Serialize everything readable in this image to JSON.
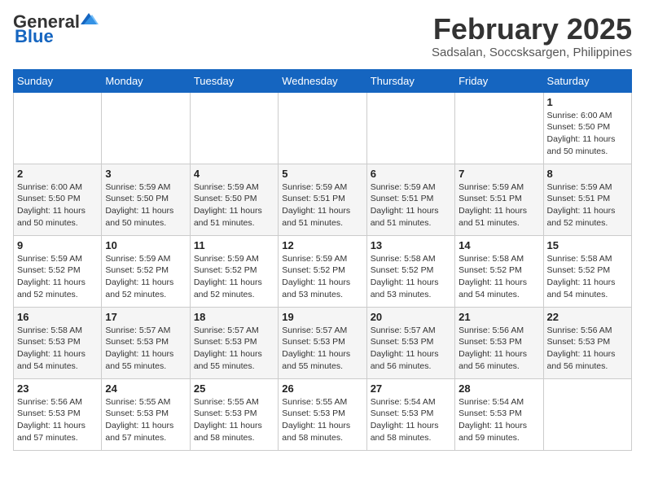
{
  "header": {
    "logo_general": "General",
    "logo_blue": "Blue",
    "month_title": "February 2025",
    "location": "Sadsalan, Soccsksargen, Philippines"
  },
  "weekdays": [
    "Sunday",
    "Monday",
    "Tuesday",
    "Wednesday",
    "Thursday",
    "Friday",
    "Saturday"
  ],
  "weeks": [
    [
      {
        "day": "",
        "info": ""
      },
      {
        "day": "",
        "info": ""
      },
      {
        "day": "",
        "info": ""
      },
      {
        "day": "",
        "info": ""
      },
      {
        "day": "",
        "info": ""
      },
      {
        "day": "",
        "info": ""
      },
      {
        "day": "1",
        "info": "Sunrise: 6:00 AM\nSunset: 5:50 PM\nDaylight: 11 hours\nand 50 minutes."
      }
    ],
    [
      {
        "day": "2",
        "info": "Sunrise: 6:00 AM\nSunset: 5:50 PM\nDaylight: 11 hours\nand 50 minutes."
      },
      {
        "day": "3",
        "info": "Sunrise: 5:59 AM\nSunset: 5:50 PM\nDaylight: 11 hours\nand 50 minutes."
      },
      {
        "day": "4",
        "info": "Sunrise: 5:59 AM\nSunset: 5:50 PM\nDaylight: 11 hours\nand 51 minutes."
      },
      {
        "day": "5",
        "info": "Sunrise: 5:59 AM\nSunset: 5:51 PM\nDaylight: 11 hours\nand 51 minutes."
      },
      {
        "day": "6",
        "info": "Sunrise: 5:59 AM\nSunset: 5:51 PM\nDaylight: 11 hours\nand 51 minutes."
      },
      {
        "day": "7",
        "info": "Sunrise: 5:59 AM\nSunset: 5:51 PM\nDaylight: 11 hours\nand 51 minutes."
      },
      {
        "day": "8",
        "info": "Sunrise: 5:59 AM\nSunset: 5:51 PM\nDaylight: 11 hours\nand 52 minutes."
      }
    ],
    [
      {
        "day": "9",
        "info": "Sunrise: 5:59 AM\nSunset: 5:52 PM\nDaylight: 11 hours\nand 52 minutes."
      },
      {
        "day": "10",
        "info": "Sunrise: 5:59 AM\nSunset: 5:52 PM\nDaylight: 11 hours\nand 52 minutes."
      },
      {
        "day": "11",
        "info": "Sunrise: 5:59 AM\nSunset: 5:52 PM\nDaylight: 11 hours\nand 52 minutes."
      },
      {
        "day": "12",
        "info": "Sunrise: 5:59 AM\nSunset: 5:52 PM\nDaylight: 11 hours\nand 53 minutes."
      },
      {
        "day": "13",
        "info": "Sunrise: 5:58 AM\nSunset: 5:52 PM\nDaylight: 11 hours\nand 53 minutes."
      },
      {
        "day": "14",
        "info": "Sunrise: 5:58 AM\nSunset: 5:52 PM\nDaylight: 11 hours\nand 54 minutes."
      },
      {
        "day": "15",
        "info": "Sunrise: 5:58 AM\nSunset: 5:52 PM\nDaylight: 11 hours\nand 54 minutes."
      }
    ],
    [
      {
        "day": "16",
        "info": "Sunrise: 5:58 AM\nSunset: 5:53 PM\nDaylight: 11 hours\nand 54 minutes."
      },
      {
        "day": "17",
        "info": "Sunrise: 5:57 AM\nSunset: 5:53 PM\nDaylight: 11 hours\nand 55 minutes."
      },
      {
        "day": "18",
        "info": "Sunrise: 5:57 AM\nSunset: 5:53 PM\nDaylight: 11 hours\nand 55 minutes."
      },
      {
        "day": "19",
        "info": "Sunrise: 5:57 AM\nSunset: 5:53 PM\nDaylight: 11 hours\nand 55 minutes."
      },
      {
        "day": "20",
        "info": "Sunrise: 5:57 AM\nSunset: 5:53 PM\nDaylight: 11 hours\nand 56 minutes."
      },
      {
        "day": "21",
        "info": "Sunrise: 5:56 AM\nSunset: 5:53 PM\nDaylight: 11 hours\nand 56 minutes."
      },
      {
        "day": "22",
        "info": "Sunrise: 5:56 AM\nSunset: 5:53 PM\nDaylight: 11 hours\nand 56 minutes."
      }
    ],
    [
      {
        "day": "23",
        "info": "Sunrise: 5:56 AM\nSunset: 5:53 PM\nDaylight: 11 hours\nand 57 minutes."
      },
      {
        "day": "24",
        "info": "Sunrise: 5:55 AM\nSunset: 5:53 PM\nDaylight: 11 hours\nand 57 minutes."
      },
      {
        "day": "25",
        "info": "Sunrise: 5:55 AM\nSunset: 5:53 PM\nDaylight: 11 hours\nand 58 minutes."
      },
      {
        "day": "26",
        "info": "Sunrise: 5:55 AM\nSunset: 5:53 PM\nDaylight: 11 hours\nand 58 minutes."
      },
      {
        "day": "27",
        "info": "Sunrise: 5:54 AM\nSunset: 5:53 PM\nDaylight: 11 hours\nand 58 minutes."
      },
      {
        "day": "28",
        "info": "Sunrise: 5:54 AM\nSunset: 5:53 PM\nDaylight: 11 hours\nand 59 minutes."
      },
      {
        "day": "",
        "info": ""
      }
    ]
  ]
}
